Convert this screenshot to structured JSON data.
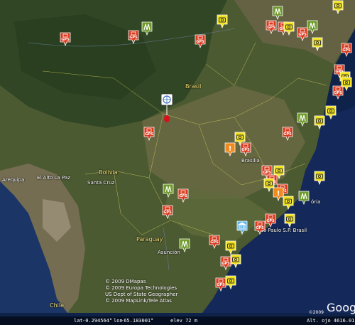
{
  "map": {
    "country_labels": [
      {
        "id": "brasil",
        "text": "Brasil"
      },
      {
        "id": "bolivia",
        "text": "Bolivia"
      },
      {
        "id": "paraguay",
        "text": "Paraguay"
      },
      {
        "id": "chile",
        "text": "Chile"
      }
    ],
    "city_labels": [
      {
        "id": "brasilia",
        "text": "Brasília"
      },
      {
        "id": "la-paz",
        "text": "El Alto La Paz"
      },
      {
        "id": "santa-cruz",
        "text": "Santa Cruz"
      },
      {
        "id": "arequipa",
        "text": "Arequipa"
      },
      {
        "id": "asuncion",
        "text": "Asunción"
      },
      {
        "id": "sao-paulo",
        "text": "São Paulo   S.P. Brasil"
      },
      {
        "id": "vitoria",
        "text": "ória"
      }
    ],
    "marker_gps_label": "GPS",
    "marker_warning_label": "!",
    "colors": {
      "gps": "#d93a1e",
      "camera": "#f2e21c",
      "tree": "#6f9b2c",
      "warning": "#f08a1c",
      "museum": "#62b6e8",
      "pushpin": "#d8101e"
    }
  },
  "attribution": [
    "© 2009 DMapas",
    "© 2009 Europa Technologies",
    "US Dept of State Geographer",
    "© 2009 MapLink/Tele Atlas"
  ],
  "logo": {
    "text": "Goog",
    "copyright": "©2009"
  },
  "status_bar": {
    "lat_label": "lat",
    "lat": "-0.294564°",
    "lon_label": "lon",
    "lon": "-65.183001°",
    "elev": "elev  72 m",
    "alt": "Alt. ojo  4616.01"
  }
}
